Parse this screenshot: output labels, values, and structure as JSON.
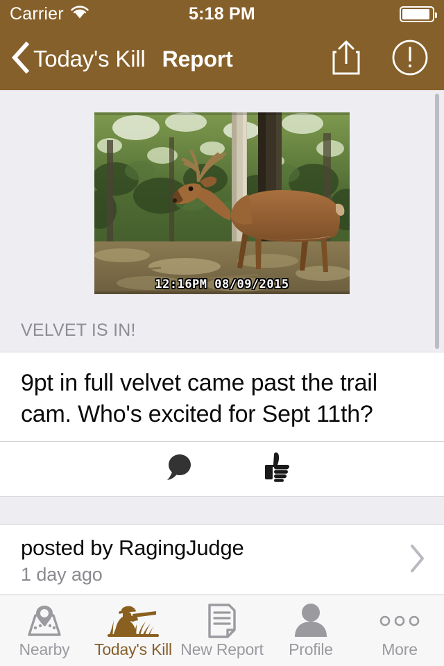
{
  "status_bar": {
    "carrier": "Carrier",
    "wifi_icon": "wifi-icon",
    "time": "5:18 PM",
    "battery_icon": "battery-icon",
    "battery_level_pct": 92
  },
  "nav_bar": {
    "back_label": "Today's Kill",
    "back_icon": "chevron-left-icon",
    "title": "Report",
    "share_icon": "share-icon",
    "report_icon": "exclamation-circle-icon",
    "background_color": "#86602a",
    "tint_color": "#ffffff"
  },
  "post": {
    "photo": {
      "alt": "trail camera photo of a whitetail buck in velvet standing in the woods",
      "timestamp_overlay": "12:16PM  08/09/2015"
    },
    "section_title": "VELVET IS IN!",
    "body": "9pt in full velvet came past the trail cam. Who's excited for Sept 11th?",
    "actions": [
      {
        "name": "comment-button",
        "icon": "speech-bubble-icon"
      },
      {
        "name": "like-button",
        "icon": "thumbs-up-icon"
      }
    ],
    "posted_by": "posted by RagingJudge",
    "posted_time": "1 day ago",
    "disclosure_icon": "chevron-right-icon"
  },
  "scrollbar": {
    "name": "vertical-scroll-indicator"
  },
  "tab_bar": {
    "active_color": "#86602a",
    "inactive_color": "#9a9a9f",
    "items": [
      {
        "label": "Nearby",
        "icon": "map-pin-icon",
        "active": false
      },
      {
        "label": "Today's Kill",
        "icon": "hunter-rifle-icon",
        "active": true
      },
      {
        "label": "New Report",
        "icon": "document-icon",
        "active": false
      },
      {
        "label": "Profile",
        "icon": "person-icon",
        "active": false
      },
      {
        "label": "More",
        "icon": "ellipsis-icon",
        "active": false
      }
    ]
  }
}
